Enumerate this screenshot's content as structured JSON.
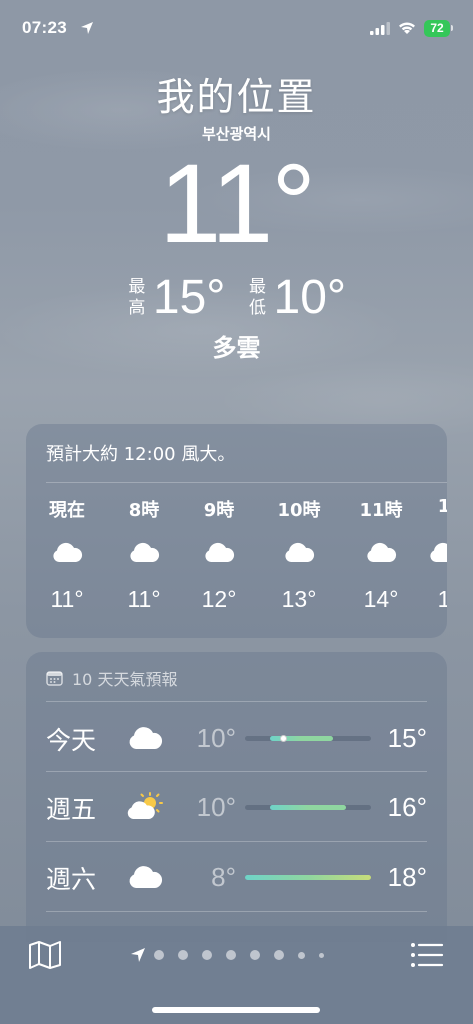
{
  "status": {
    "time": "07:23",
    "battery": "72"
  },
  "header": {
    "title": "我的位置",
    "subtitle": "부산광역시",
    "current_temp": "11°",
    "high_label": "最高",
    "high": "15°",
    "low_label": "最低",
    "low": "10°",
    "condition": "多雲"
  },
  "hourly": {
    "summary": "預計大約 12:00 風大。",
    "items": [
      {
        "time": "現在",
        "icon": "cloud-icon",
        "temp": "11°"
      },
      {
        "time": "8時",
        "icon": "cloud-icon",
        "temp": "11°"
      },
      {
        "time": "9時",
        "icon": "cloud-icon",
        "temp": "12°"
      },
      {
        "time": "10時",
        "icon": "cloud-icon",
        "temp": "13°"
      },
      {
        "time": "11時",
        "icon": "cloud-icon",
        "temp": "14°"
      },
      {
        "time": "1",
        "icon": "cloud-icon",
        "temp": "1"
      }
    ]
  },
  "daily": {
    "header": "10 天天氣預報",
    "range": {
      "min": 8,
      "max": 18
    },
    "days": [
      {
        "name": "今天",
        "icon": "cloud-icon",
        "low": "10°",
        "high": "15°",
        "low_value": 10,
        "high_value": 15,
        "current_value": 11
      },
      {
        "name": "週五",
        "icon": "partly-sunny-icon",
        "low": "10°",
        "high": "16°",
        "low_value": 10,
        "high_value": 16
      },
      {
        "name": "週六",
        "icon": "cloud-icon",
        "low": "8°",
        "high": "18°",
        "low_value": 8,
        "high_value": 18
      }
    ]
  },
  "colors": {
    "bar_cool": "#6fd3c8",
    "bar_mild": "#8fd6a0",
    "bar_warm": "#c7dc7a",
    "battery": "#34c759"
  },
  "bottom_bar": {
    "left_icon": "map-icon",
    "right_icon": "list-icon",
    "page_count": 8,
    "current_page": "location-arrow-icon"
  }
}
